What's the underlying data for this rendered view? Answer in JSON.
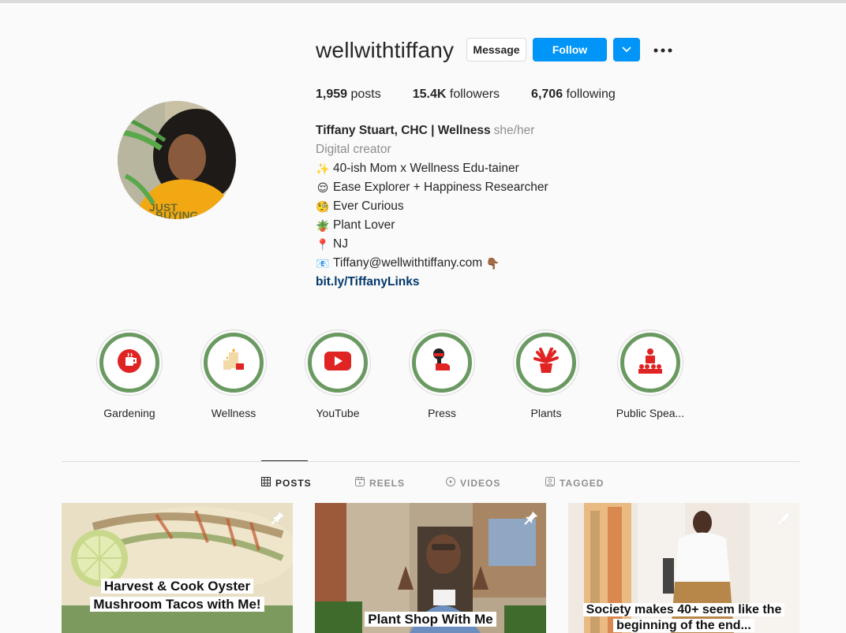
{
  "profile": {
    "username": "wellwithtiffany",
    "message_label": "Message",
    "follow_label": "Follow",
    "stats": {
      "posts_count": "1,959",
      "posts_label": "posts",
      "followers_count": "15.4K",
      "followers_label": "followers",
      "following_count": "6,706",
      "following_label": "following"
    },
    "bio": {
      "name": "Tiffany Stuart, CHC | Wellness",
      "pronouns": "she/her",
      "category": "Digital creator",
      "lines": [
        {
          "emoji": "✨",
          "text": "40-ish Mom x Wellness Edu-tainer"
        },
        {
          "emoji": "😌",
          "text": "Ease Explorer + Happiness Researcher"
        },
        {
          "emoji": "🧐",
          "text": "Ever Curious"
        },
        {
          "emoji": "🪴",
          "text": "Plant Lover"
        },
        {
          "emoji": "📍",
          "text": "NJ"
        },
        {
          "emoji": "📧",
          "text": "Tiffany@wellwithtiffany.com"
        }
      ],
      "trailing_emoji": "👇🏾",
      "link": "bit.ly/TiffanyLinks"
    }
  },
  "highlights": [
    {
      "label": "Gardening",
      "icon": "cup-icon"
    },
    {
      "label": "Wellness",
      "icon": "candles-icon"
    },
    {
      "label": "YouTube",
      "icon": "youtube-icon"
    },
    {
      "label": "Press",
      "icon": "microphone-icon"
    },
    {
      "label": "Plants",
      "icon": "plant-icon"
    },
    {
      "label": "Public Spea...",
      "icon": "podium-icon"
    }
  ],
  "tabs": [
    {
      "label": "POSTS",
      "icon": "grid-icon",
      "active": true
    },
    {
      "label": "REELS",
      "icon": "reels-icon",
      "active": false
    },
    {
      "label": "VIDEOS",
      "icon": "play-icon",
      "active": false
    },
    {
      "label": "TAGGED",
      "icon": "tag-icon",
      "active": false
    }
  ],
  "posts": [
    {
      "caption": [
        "Harvest & Cook Oyster",
        "Mushroom Tacos with  Me!"
      ]
    },
    {
      "caption": [
        "Plant Shop With Me"
      ]
    },
    {
      "caption": [
        "Society makes 40+ seem like the",
        "beginning of the end..."
      ]
    }
  ],
  "colors": {
    "accent_blue": "#0095f6",
    "highlight_ring_green": "#6a9a62",
    "highlight_icon_red": "#e02424",
    "link_blue": "#00376b"
  }
}
